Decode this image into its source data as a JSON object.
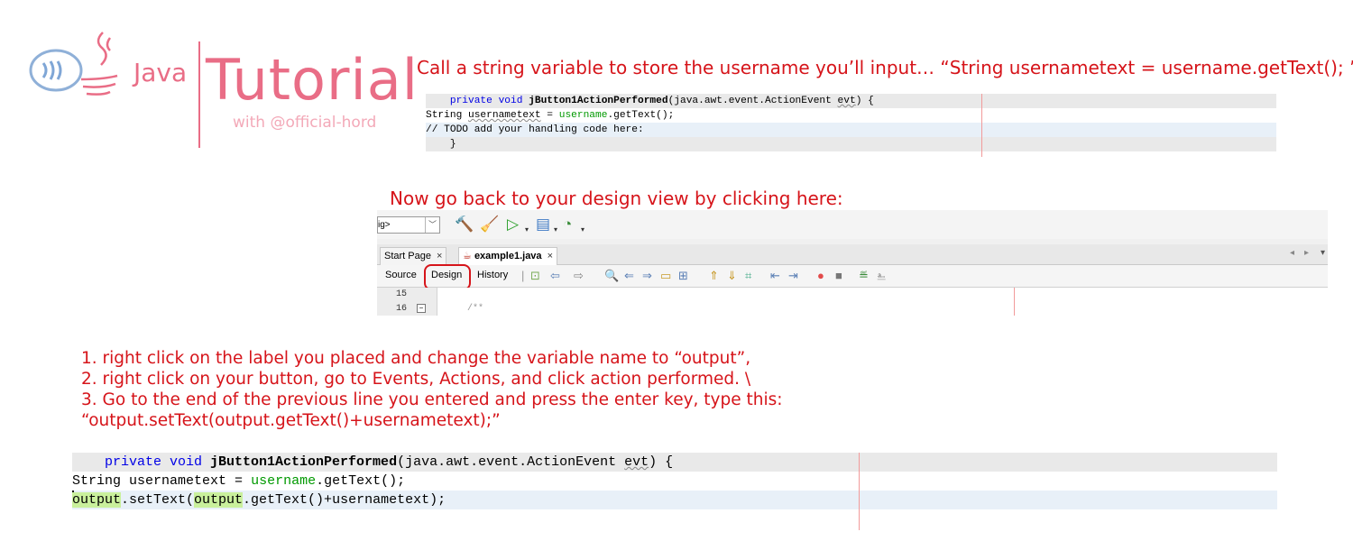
{
  "logo": {
    "java": "Java",
    "tutorial": "Tutorial",
    "with": "with @official-hord"
  },
  "caption1": "Call a string variable to store the username you’ll input… “String usernametext = username.getText(); ”",
  "caption2": "Now go back to your design view by clicking here:",
  "code1": {
    "line1_pre": "    private void ",
    "line1_method": "jButton1ActionPerformed",
    "line1_args": "(java.awt.event.ActionEvent ",
    "line1_evt": "evt",
    "line1_end": ") {",
    "line2_a": "String ",
    "line2_var": "usernametext",
    "line2_b": " = ",
    "line2_user": "username",
    "line2_c": ".getText();",
    "line3": "// TODO add your handling code here:",
    "line4": "    }"
  },
  "ide": {
    "combo_value": "ig>",
    "tabs": [
      {
        "label": "Start Page",
        "close": "×"
      },
      {
        "label": "example1.java",
        "close": "×"
      }
    ],
    "subtabs": {
      "source": "Source",
      "design": "Design",
      "history": "History"
    },
    "line_numbers": [
      "15",
      "16"
    ],
    "line16_code": "/**",
    "colors": {
      "accent": "#d6141a",
      "run": "#2ca02c"
    }
  },
  "steps": [
    "1. right click on the label you placed and change the variable name to “output”,",
    "2. right click on your button, go to Events, Actions, and click action performed. \\",
    "3. Go to the end of the previous line you entered and press the enter key, type this:",
    "“output.setText(output.getText()+usernametext);”"
  ],
  "code2": {
    "line1_pre": "    private void ",
    "line1_method": "jButton1ActionPerformed",
    "line1_args": "(java.awt.event.ActionEvent ",
    "line1_evt": "evt",
    "line1_end": ") {",
    "line2_a": "String ",
    "line2_var": "usernametext",
    "line2_b": " = ",
    "line2_user": "username",
    "line2_c": ".getText();",
    "line3_out1": "output",
    "line3_a": ".setText(",
    "line3_out2": "output",
    "line3_b": ".getText()+usernametext);"
  }
}
